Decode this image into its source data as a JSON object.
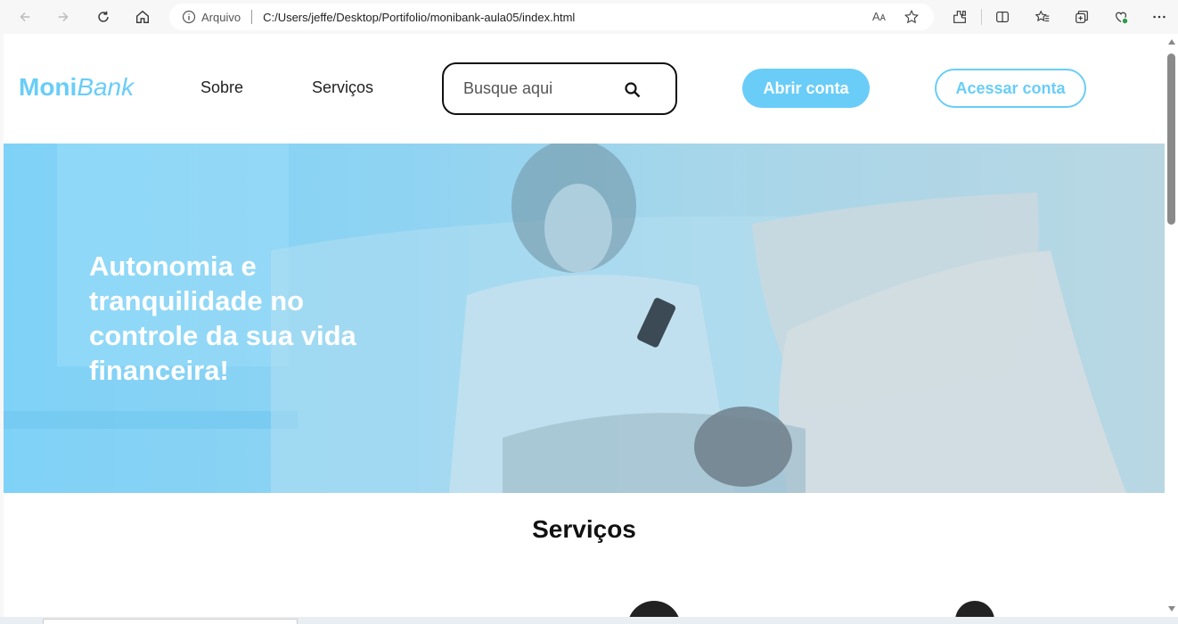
{
  "browser": {
    "address_protocol": "Arquivo",
    "address_url": "C:/Users/jeffe/Desktop/Portifolio/monibank-aula05/index.html",
    "read_aloud": "Aᴀ"
  },
  "site": {
    "logo_moni": "Moni",
    "logo_bank": "Bank",
    "nav": {
      "about": "Sobre",
      "services": "Serviços"
    },
    "search": {
      "placeholder": "Busque aqui"
    },
    "buttons": {
      "open_account": "Abrir conta",
      "access_account": "Acessar conta"
    },
    "hero": {
      "title": "Autonomia e tranquilidade no controle da sua vida financeira!"
    },
    "services_heading": "Serviços"
  },
  "colors": {
    "brand": "#69cdf8",
    "hero_overlay": "#7fd2f7"
  }
}
